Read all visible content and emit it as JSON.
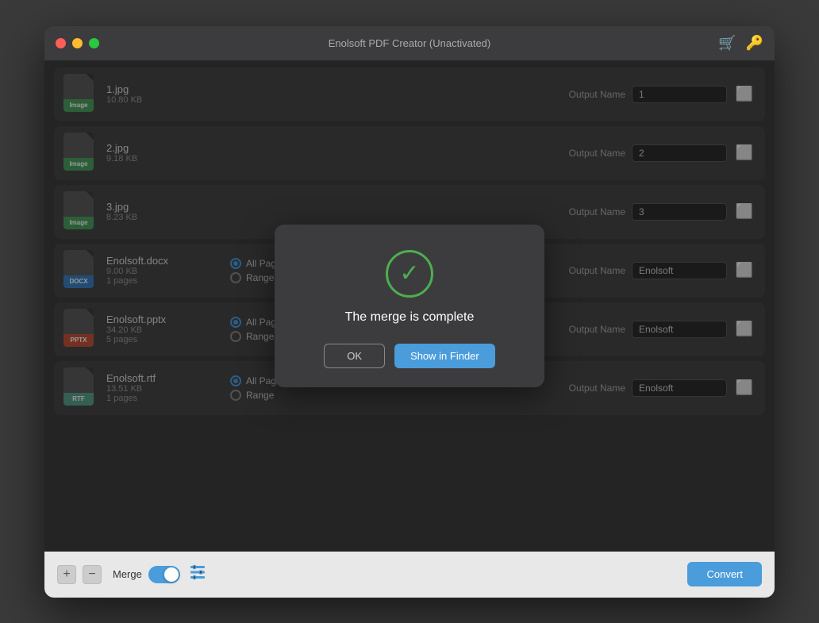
{
  "window": {
    "title": "Enolsoft PDF Creator (Unactivated)"
  },
  "titlebar": {
    "buttons": {
      "close": "close",
      "minimize": "minimize",
      "maximize": "maximize"
    },
    "cart_icon": "🛒",
    "key_icon": "🔑"
  },
  "files": [
    {
      "name": "1.jpg",
      "size": "10.80 KB",
      "pages": null,
      "type": "IMAGE",
      "badge_class": "badge-image",
      "output_name": "1",
      "has_options": false
    },
    {
      "name": "2.jpg",
      "size": "9.18 KB",
      "pages": null,
      "type": "IMAGE",
      "badge_class": "badge-image",
      "output_name": "2",
      "has_options": false
    },
    {
      "name": "3.jpg",
      "size": "8.23 KB",
      "pages": null,
      "type": "IMAGE",
      "badge_class": "badge-image",
      "output_name": "3",
      "has_options": false
    },
    {
      "name": "Enolsoft.docx",
      "size": "9.00 KB",
      "pages": "1 pages",
      "type": "DOCX",
      "badge_class": "badge-docx",
      "output_name": "Enolsoft",
      "has_options": true,
      "option_all": "All Pages",
      "option_range": "Range"
    },
    {
      "name": "Enolsoft.pptx",
      "size": "34.20 KB",
      "pages": "5 pages",
      "type": "PPTX",
      "badge_class": "badge-pptx",
      "output_name": "Enolsoft",
      "has_options": true,
      "option_all": "All Pages",
      "option_range": "Range"
    },
    {
      "name": "Enolsoft.rtf",
      "size": "13.51 KB",
      "pages": "1 pages",
      "type": "RTF",
      "badge_class": "badge-rtf",
      "output_name": "Enolsoft",
      "has_options": true,
      "option_all": "All Pages",
      "option_range": "Range"
    }
  ],
  "output_label": "Output Name",
  "bottom_bar": {
    "merge_label": "Merge",
    "convert_label": "Convert"
  },
  "modal": {
    "title": "The merge is complete",
    "ok_label": "OK",
    "finder_label": "Show in Finder"
  }
}
